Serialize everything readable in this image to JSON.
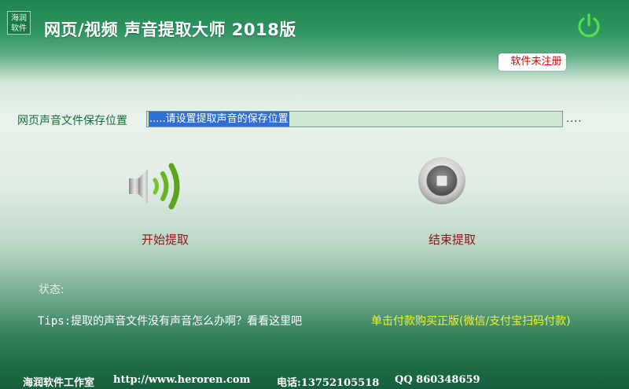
{
  "app": {
    "logo_text": "海润软件",
    "title": "网页/视频 声音提取大师 2018版",
    "registration_status": "软件未注册"
  },
  "colors": {
    "accent_green": "#1f8450",
    "power_icon": "#4fe04f",
    "registration_text": "#d10000",
    "action_label": "#8a1a1a",
    "buy_link": "#f3f32a"
  },
  "save_path": {
    "label": "网页声音文件保存位置",
    "value": ".....请设置提取声音的保存位置",
    "browse_label": "...."
  },
  "actions": {
    "start_label": "开始提取",
    "start_icon": "speaker-sound-icon",
    "stop_label": "结束提取",
    "stop_icon": "stop-icon"
  },
  "status": {
    "label": "状态:"
  },
  "tips": {
    "text": "Tips:提取的声音文件没有声音怎么办啊？看看这里吧"
  },
  "buy": {
    "text": "单击付款购买正版(微信/支付宝扫码付款)"
  },
  "footer": {
    "company": "海润软件工作室",
    "website": "http://www.heroren.com",
    "phone": "电话:13752105518",
    "qq": "QQ 860348659"
  }
}
